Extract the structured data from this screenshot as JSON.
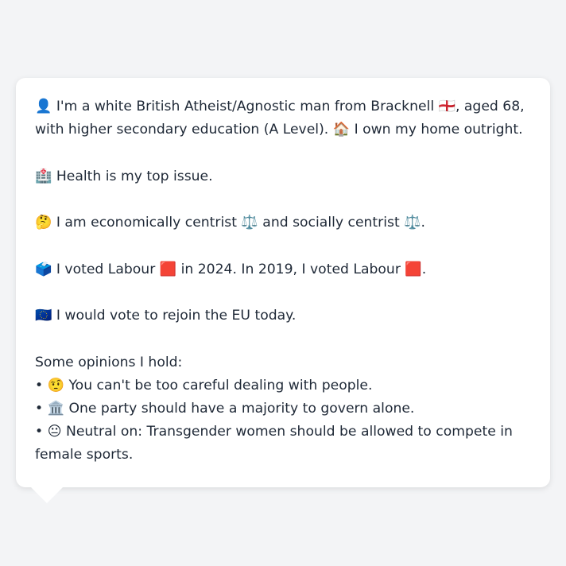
{
  "profile": {
    "intro_text": "👤 I'm a white British Atheist/Agnostic man from Bracknell 🏴󠁧󠁢󠁥󠁮󠁧󠁿, aged 68, with higher secondary education (A Level). 🏠 I own my home outright.",
    "health_text": "🏥 Health is my top issue.",
    "economics_text": "🤔 I am economically centrist ⚖️ and socially centrist ⚖️.",
    "voting_text": "🗳️ I voted Labour 🟥 in 2024. In 2019, I voted Labour 🟥.",
    "eu_text": "🇪🇺 I would vote to rejoin the EU today.",
    "opinions_heading": "Some opinions I hold:",
    "opinions": [
      "• 🤨 You can't be too careful dealing with people.",
      "• 🏛️ One party should have a majority to govern alone.",
      "• 😐 Neutral on: Transgender women should be allowed to compete in female sports."
    ]
  },
  "colors": {
    "background": "#f3f4f6",
    "bubble": "#ffffff",
    "text": "#1f2937"
  }
}
